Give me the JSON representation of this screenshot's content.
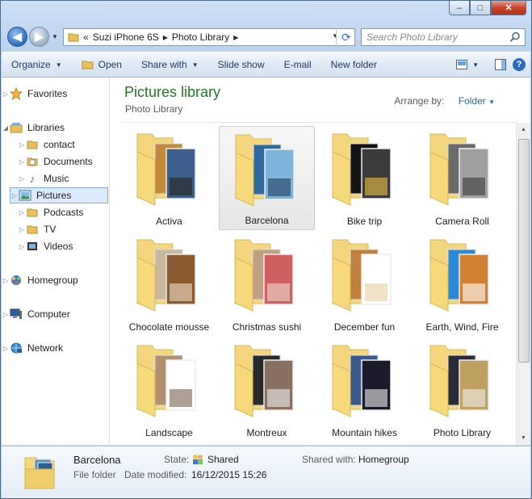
{
  "window": {
    "caption": {
      "minimize": "–",
      "maximize": "□",
      "close": "✕"
    }
  },
  "address": {
    "overflow": "«",
    "device": "Suzi iPhone 6S",
    "folder": "Photo Library",
    "search_placeholder": "Search Photo Library"
  },
  "toolbar": {
    "organize": "Organize",
    "open": "Open",
    "share_with": "Share with",
    "slide_show": "Slide show",
    "email": "E-mail",
    "new_folder": "New folder",
    "help": "?"
  },
  "navpane": {
    "favorites": "Favorites",
    "libraries": "Libraries",
    "contact": "contact",
    "documents": "Documents",
    "music": "Music",
    "pictures": "Pictures",
    "podcasts": "Podcasts",
    "tv": "TV",
    "videos": "Videos",
    "homegroup": "Homegroup",
    "computer": "Computer",
    "network": "Network"
  },
  "content": {
    "title": "Pictures library",
    "subtitle": "Photo Library",
    "arrange_label": "Arrange by:",
    "arrange_value": "Folder",
    "folders": [
      "Activa",
      "Barcelona",
      "Bike trip",
      "Camera Roll",
      "Chocolate mousse",
      "Christmas sushi",
      "December fun",
      "Earth, Wind, Fire",
      "Landscape",
      "Montreux",
      "Mountain hikes",
      "Photo Library"
    ],
    "selected": "Barcelona"
  },
  "details": {
    "name": "Barcelona",
    "type": "File folder",
    "state_label": "State:",
    "state_value": "Shared",
    "shared_label": "Shared with:",
    "shared_value": "Homegroup",
    "modified_label": "Date modified:",
    "modified_value": "16/12/2015 15:26"
  },
  "colors": {
    "title_green": "#1e7a1e",
    "link_blue": "#1e66b4",
    "folder": "#f5d77a"
  }
}
